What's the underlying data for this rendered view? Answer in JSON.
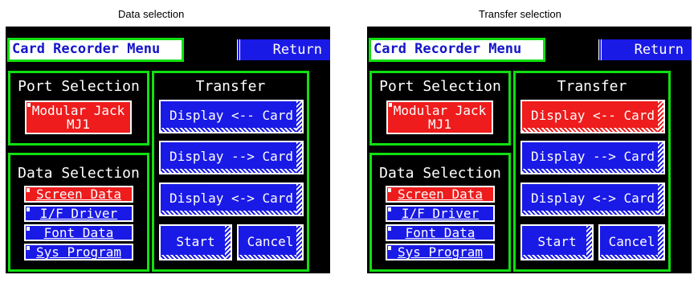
{
  "panels": [
    {
      "caption": "Data selection",
      "title": "Card Recorder Menu",
      "return_label": "Return",
      "port": {
        "heading": "Port Selection",
        "button_line1": "Modular Jack",
        "button_line2": "MJ1"
      },
      "data": {
        "heading": "Data Selection",
        "items": [
          {
            "label": "Screen Data",
            "active": true
          },
          {
            "label": "I/F Driver",
            "active": false
          },
          {
            "label": "Font Data",
            "active": false
          },
          {
            "label": "Sys Program",
            "active": false
          }
        ]
      },
      "transfer": {
        "heading": "Transfer",
        "buttons": [
          {
            "label": "Display <-- Card",
            "active": false
          },
          {
            "label": "Display --> Card",
            "active": false
          },
          {
            "label": "Display <-> Card",
            "active": false
          }
        ],
        "start_label": "Start",
        "cancel_label": "Cancel"
      }
    },
    {
      "caption": "Transfer selection",
      "title": "Card Recorder Menu",
      "return_label": "Return",
      "port": {
        "heading": "Port Selection",
        "button_line1": "Modular Jack",
        "button_line2": "MJ1"
      },
      "data": {
        "heading": "Data Selection",
        "items": [
          {
            "label": "Screen Data",
            "active": true
          },
          {
            "label": "I/F Driver",
            "active": false
          },
          {
            "label": "Font Data",
            "active": false
          },
          {
            "label": "Sys Program",
            "active": false
          }
        ]
      },
      "transfer": {
        "heading": "Transfer",
        "buttons": [
          {
            "label": "Display <-- Card",
            "active": true
          },
          {
            "label": "Display --> Card",
            "active": false
          },
          {
            "label": "Display <-> Card",
            "active": false
          }
        ],
        "start_label": "Start",
        "cancel_label": "Cancel"
      }
    }
  ],
  "colors": {
    "active": "#ee1c1c",
    "inactive": "#1a1ae6",
    "frame": "#10e010",
    "title_text": "#1515c8"
  }
}
